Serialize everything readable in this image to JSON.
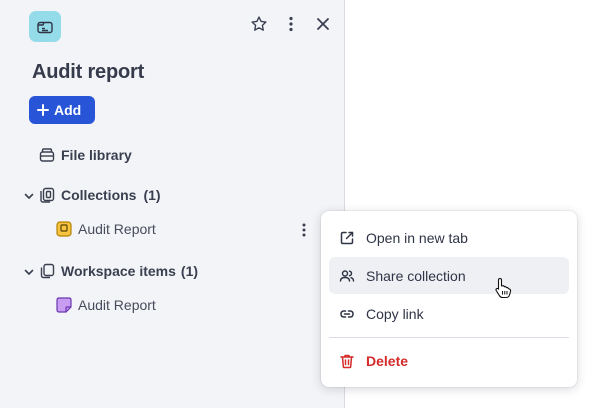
{
  "colors": {
    "panel_bg": "#f3f4f7",
    "accent": "#2855d8",
    "app_icon_bg": "#94dcea",
    "danger": "#d42b2b",
    "hover_bg": "#eef0f4",
    "collection_icon": "#f5c542",
    "workspace_item_icon": "#c89cf0"
  },
  "header": {
    "app_icon": "folder-card-icon",
    "actions": [
      "star-icon",
      "more-vertical-icon",
      "close-icon"
    ]
  },
  "page_title": "Audit report",
  "add_button": {
    "label": "Add",
    "icon": "plus-icon"
  },
  "tree": {
    "file_library": {
      "label": "File library",
      "icon": "archive-icon"
    },
    "collections": {
      "label": "Collections",
      "count": "(1)",
      "icon": "collections-icon",
      "items": [
        {
          "label": "Audit Report",
          "icon": "collection-square-icon"
        }
      ]
    },
    "workspace_items": {
      "label": "Workspace items",
      "count": "(1)",
      "icon": "workspace-items-icon",
      "items": [
        {
          "label": "Audit Report",
          "icon": "note-icon"
        }
      ]
    }
  },
  "context_menu": {
    "items": [
      {
        "label": "Open in new tab",
        "icon": "external-link-icon"
      },
      {
        "label": "Share collection",
        "icon": "users-icon"
      },
      {
        "label": "Copy link",
        "icon": "link-icon"
      },
      {
        "label": "Delete",
        "icon": "trash-icon"
      }
    ]
  }
}
